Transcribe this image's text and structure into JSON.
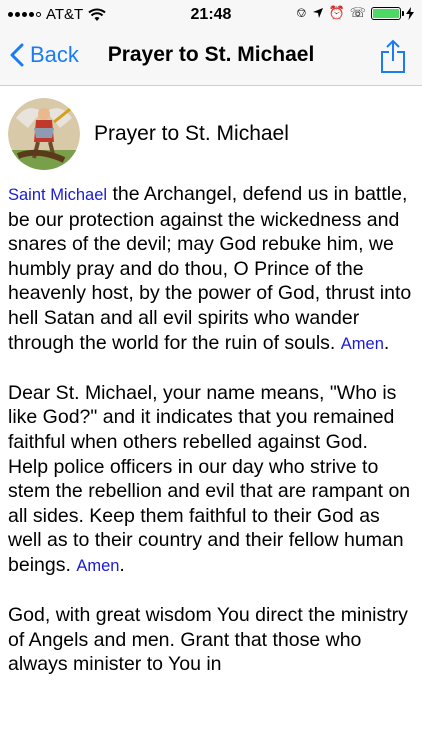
{
  "status_bar": {
    "carrier": "AT&T",
    "time": "21:48",
    "battery_level": 1.0
  },
  "nav": {
    "back_label": "Back",
    "title": "Prayer to St. Michael"
  },
  "header": {
    "title": "Prayer to St. Michael"
  },
  "prayer": {
    "p1_link": "Saint Michael",
    "p1_text": " the Archangel, defend us in battle, be our protection against the wickedness and snares of the devil; may God rebuke him, we humbly pray and do thou, O Prince of the heavenly host, by the power of God, thrust into hell Satan and all evil spirits who wander through the world for the ruin of souls. ",
    "p1_amen": "Amen",
    "p1_end": ".",
    "p2_text": "Dear St. Michael, your name means, \"Who is like God?\" and it indicates that you remained faithful when others rebelled against God.",
    "p3_text": "Help police officers in our day who strive to stem the rebellion and evil that are rampant on all sides. Keep them faithful to their God as well as to their country and their fellow human beings. ",
    "p3_amen": "Amen",
    "p3_end": ".",
    "p4_text": "God, with great wisdom You direct the ministry of Angels and men. Grant that those who always minister to You in"
  },
  "colors": {
    "link": "#1b1bd6",
    "ios_blue": "#1a7cf5"
  }
}
